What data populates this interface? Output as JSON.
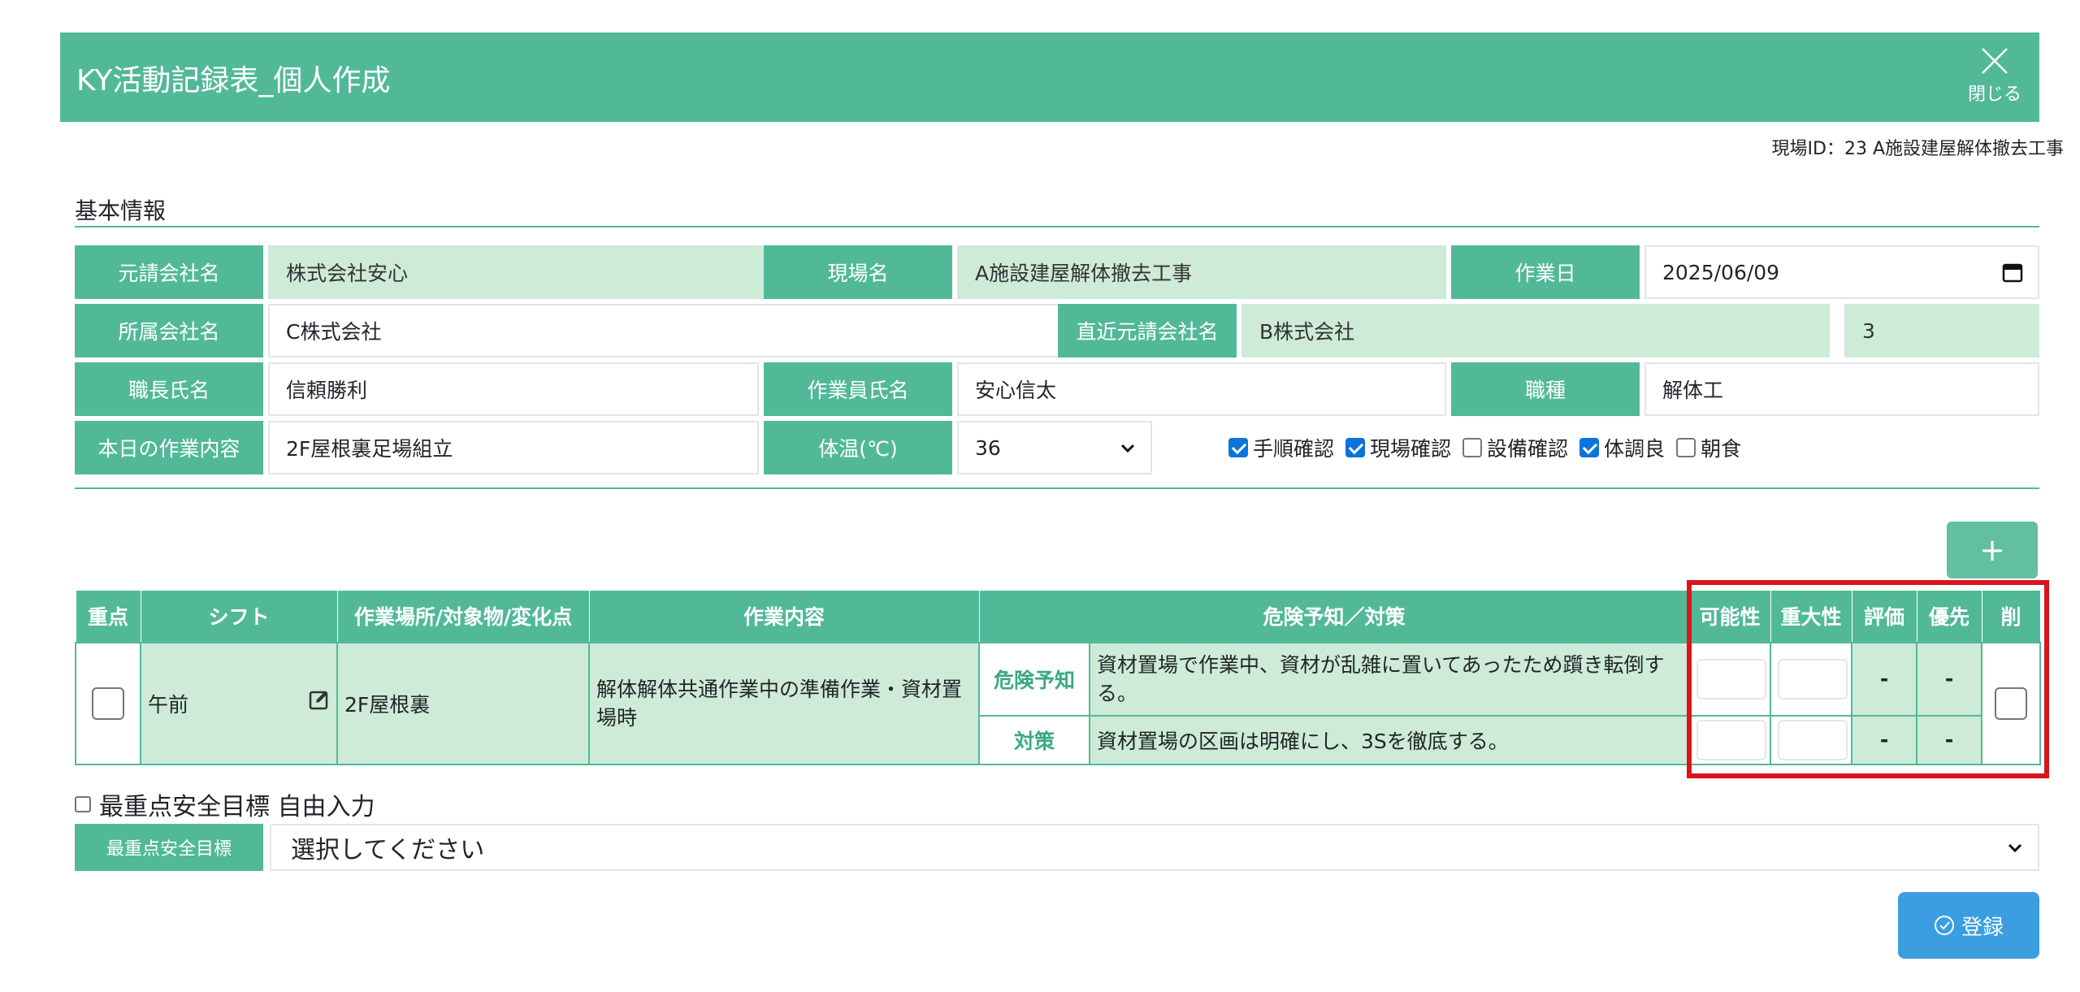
{
  "header": {
    "title": "KY活動記録表_個人作成",
    "close_label": "閉じる"
  },
  "site_id": "現場ID：23 A施設建屋解体撤去工事",
  "section_title": "基本情報",
  "info": {
    "prime_label": "元請会社名",
    "prime_value": "株式会社安心",
    "site_label": "現場名",
    "site_value": "A施設建屋解体撤去工事",
    "date_label": "作業日",
    "date_value": "2025/06/09",
    "company_label": "所属会社名",
    "company_value": "C株式会社",
    "direct_label": "直近元請会社名",
    "direct_value": "B株式会社",
    "direct_num": "3",
    "foreman_label": "職長氏名",
    "foreman_value": "信頼勝利",
    "worker_label": "作業員氏名",
    "worker_value": "安心信太",
    "trade_label": "職種",
    "trade_value": "解体工",
    "task_label": "本日の作業内容",
    "task_value": "2F屋根裏足場組立",
    "temp_label": "体温(℃)",
    "temp_value": "36",
    "checks": [
      {
        "label": "手順確認",
        "checked": true
      },
      {
        "label": "現場確認",
        "checked": true
      },
      {
        "label": "設備確認",
        "checked": false
      },
      {
        "label": "体調良",
        "checked": true
      },
      {
        "label": "朝食",
        "checked": false
      }
    ]
  },
  "add_button": "+",
  "table": {
    "headers": [
      "重点",
      "シフト",
      "作業場所/対象物/変化点",
      "作業内容",
      "危険予知／対策",
      "可能性",
      "重大性",
      "評価",
      "優先",
      "削"
    ],
    "row": {
      "shift": "午前",
      "place": "2F屋根裏",
      "work": "解体解体共通作業中の準備作業・資材置場時",
      "hazard_tag": "危険予知",
      "hazard_text": "資材置場で作業中、資材が乱雑に置いてあったため躓き転倒する。",
      "measure_tag": "対策",
      "measure_text": "資材置場の区画は明確にし、3Sを徹底する。",
      "eval1": "-",
      "prio1": "-",
      "eval2": "-",
      "prio2": "-"
    }
  },
  "free_input_label": "最重点安全目標 自由入力",
  "goal_label": "最重点安全目標",
  "goal_select": "選択してください",
  "register_label": "登録",
  "colors": {
    "accent": "#52b998",
    "light": "#cdebd7",
    "register": "#3a9ee0",
    "highlight": "#d9141c"
  }
}
